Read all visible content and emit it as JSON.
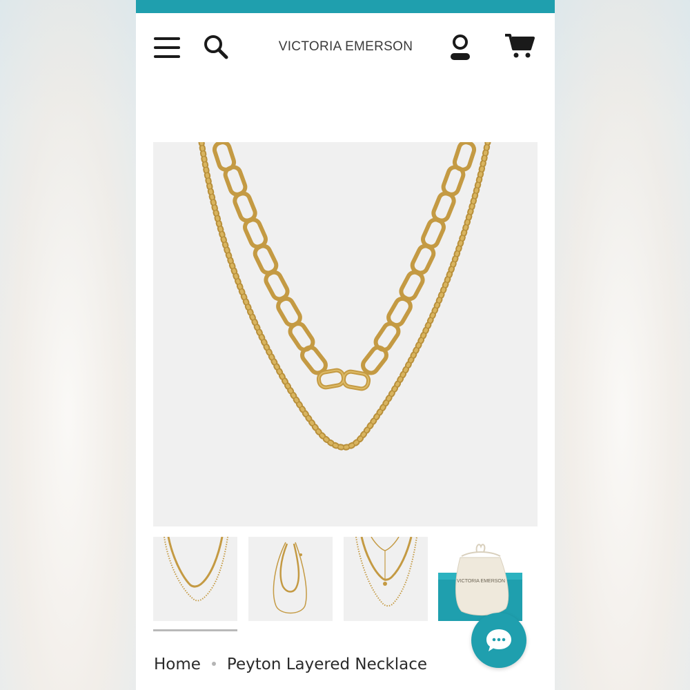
{
  "header": {
    "brand": "VICTORIA EMERSON",
    "icons": [
      "menu-icon",
      "search-icon",
      "account-icon",
      "cart-icon"
    ]
  },
  "gallery": {
    "selected_index": 0,
    "thumbnails": [
      {
        "kind": "double layered chain necklace"
      },
      {
        "kind": "full length necklace view"
      },
      {
        "kind": "layered necklace with clasp"
      },
      {
        "kind": "drawstring pouch",
        "pouch_text": "VICTORIA EMERSON"
      }
    ]
  },
  "breadcrumb": {
    "items": [
      "Home",
      "Peyton Layered Necklace"
    ]
  },
  "chat": {
    "icon": "chat-bubble-icon"
  },
  "colors": {
    "accent": "#1f9fae",
    "gold": "#c9a24a",
    "image_bg": "#f0f0f0",
    "text": "#2a2a2a"
  }
}
